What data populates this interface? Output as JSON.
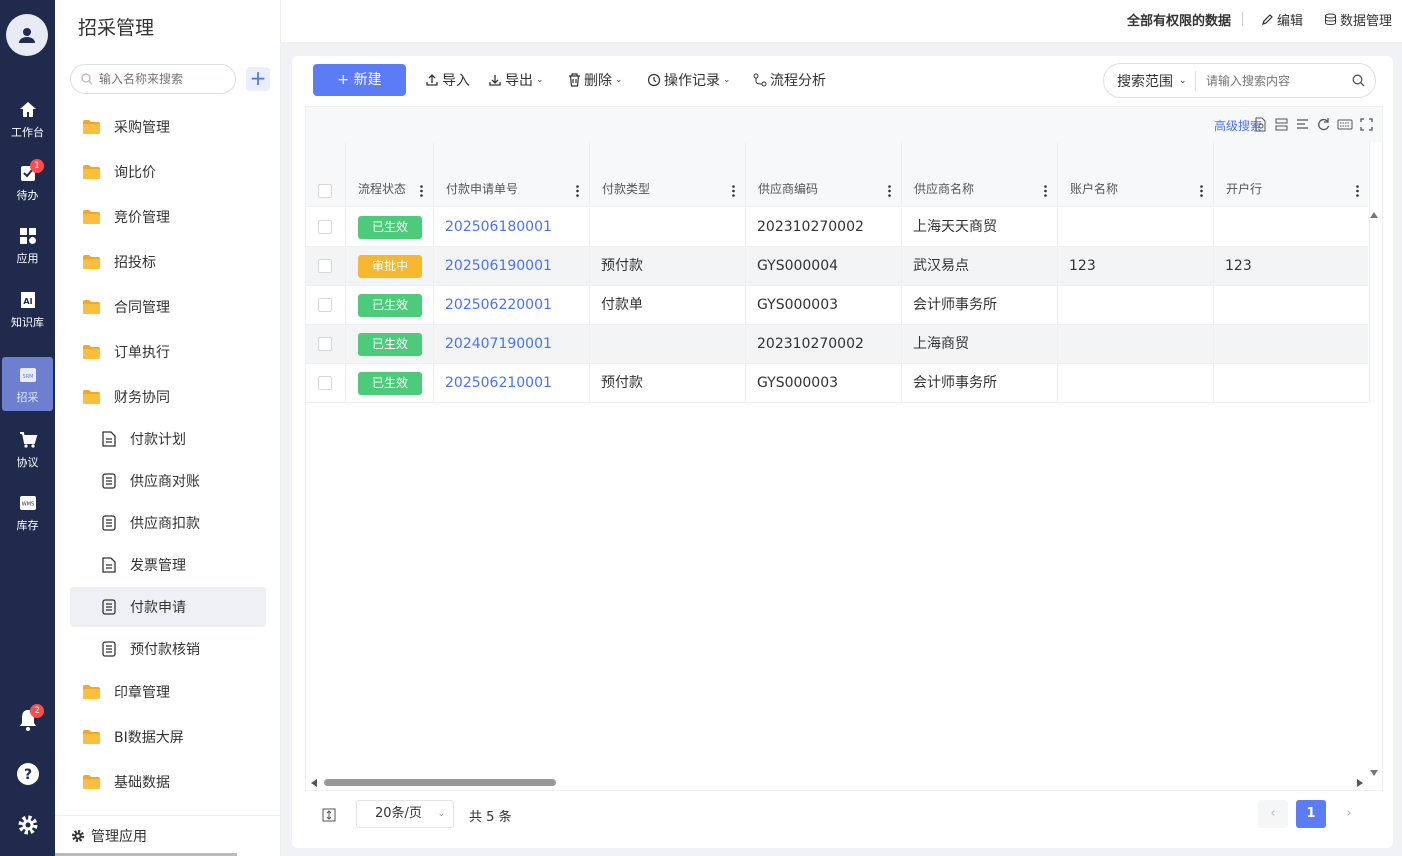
{
  "rail": {
    "items": [
      {
        "label": "工作台",
        "icon": "home-icon"
      },
      {
        "label": "待办",
        "icon": "clipboard-icon",
        "badge": "1"
      },
      {
        "label": "应用",
        "icon": "apps-icon"
      },
      {
        "label": "知识库",
        "icon": "ai-book-icon"
      },
      {
        "label": "招采",
        "icon": "srm-icon"
      },
      {
        "label": "协议",
        "icon": "cart-icon"
      },
      {
        "label": "库存",
        "icon": "wms-icon"
      }
    ],
    "notification_badge": "2",
    "srm_text": "SRM",
    "wms_text": "WMS"
  },
  "sidebar": {
    "title": "招采管理",
    "search_placeholder": "输入名称来搜索",
    "add_label": "+",
    "menu": [
      "采购管理",
      "询比价",
      "竞价管理",
      "招投标",
      "合同管理",
      "订单执行",
      "财务协同"
    ],
    "submenu": [
      "付款计划",
      "供应商对账",
      "供应商扣款",
      "发票管理",
      "付款申请",
      "预付款核销"
    ],
    "menu_after": [
      "印章管理",
      "BI数据大屏",
      "基础数据"
    ],
    "footer": "管理应用"
  },
  "topbar": {
    "permission": "全部有权限的数据",
    "edit": "编辑",
    "data_manage": "数据管理"
  },
  "toolbar": {
    "new": "+ 新建",
    "import": "导入",
    "export": "导出",
    "delete": "删除",
    "log": "操作记录",
    "flow": "流程分析",
    "scope": "搜索范围",
    "search_placeholder": "请输入搜索内容",
    "advanced": "高级搜索"
  },
  "table": {
    "headers": [
      "流程状态",
      "付款申请单号",
      "付款类型",
      "供应商编码",
      "供应商名称",
      "账户名称",
      "开户行"
    ],
    "rows": [
      {
        "status": "已生效",
        "status_color": "#4ccc7a",
        "no": "202506180001",
        "type": "",
        "code": "202310270002",
        "name": "上海天天商贸",
        "account": "",
        "bank": ""
      },
      {
        "status": "审批中",
        "status_color": "#f7b731",
        "no": "202506190001",
        "type": "预付款",
        "code": "GYS000004",
        "name": "武汉易点",
        "account": "123",
        "bank": "123"
      },
      {
        "status": "已生效",
        "status_color": "#4ccc7a",
        "no": "202506220001",
        "type": "付款单",
        "code": "GYS000003",
        "name": "会计师事务所",
        "account": "",
        "bank": ""
      },
      {
        "status": "已生效",
        "status_color": "#4ccc7a",
        "no": "202407190001",
        "type": "",
        "code": "202310270002",
        "name": "上海商贸",
        "account": "",
        "bank": ""
      },
      {
        "status": "已生效",
        "status_color": "#4ccc7a",
        "no": "202506210001",
        "type": "预付款",
        "code": "GYS000003",
        "name": "会计师事务所",
        "account": "",
        "bank": ""
      }
    ]
  },
  "pagination": {
    "page_size": "20条/页",
    "total": "共 5 条",
    "current": "1",
    "prev": "‹",
    "next": "›"
  },
  "colors": {
    "rail_bg": "#1f2a4d",
    "accent": "#5b7cf5",
    "link": "#4a73f0"
  }
}
